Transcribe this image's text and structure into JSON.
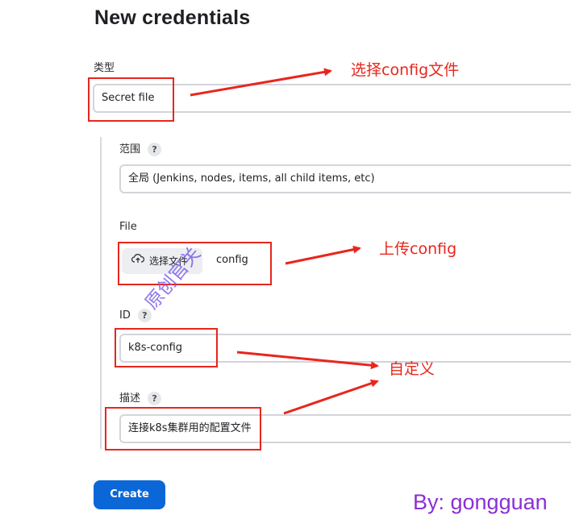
{
  "page": {
    "title": "New credentials"
  },
  "kind": {
    "label": "类型",
    "value": "Secret file"
  },
  "scope": {
    "label": "范围",
    "help": "?",
    "value": "全局 (Jenkins, nodes, items, all child items, etc)"
  },
  "file": {
    "label": "File",
    "button_label": "选择文件",
    "file_name": "config",
    "icon": "cloud-upload-icon"
  },
  "id_field": {
    "label": "ID",
    "help": "?",
    "value": "k8s-config"
  },
  "description": {
    "label": "描述",
    "help": "?",
    "value": "连接k8s集群用的配置文件"
  },
  "actions": {
    "create_label": "Create"
  },
  "annotations": {
    "note_kind": "选择config文件",
    "note_upload": "上传config",
    "note_custom": "自定义",
    "watermark": "原创官关",
    "byline": "By: gongguan",
    "color": "#e8261d"
  },
  "colors": {
    "primary": "#0b67d7",
    "annotation": "#e8261d",
    "byline": "#8a30d6"
  }
}
